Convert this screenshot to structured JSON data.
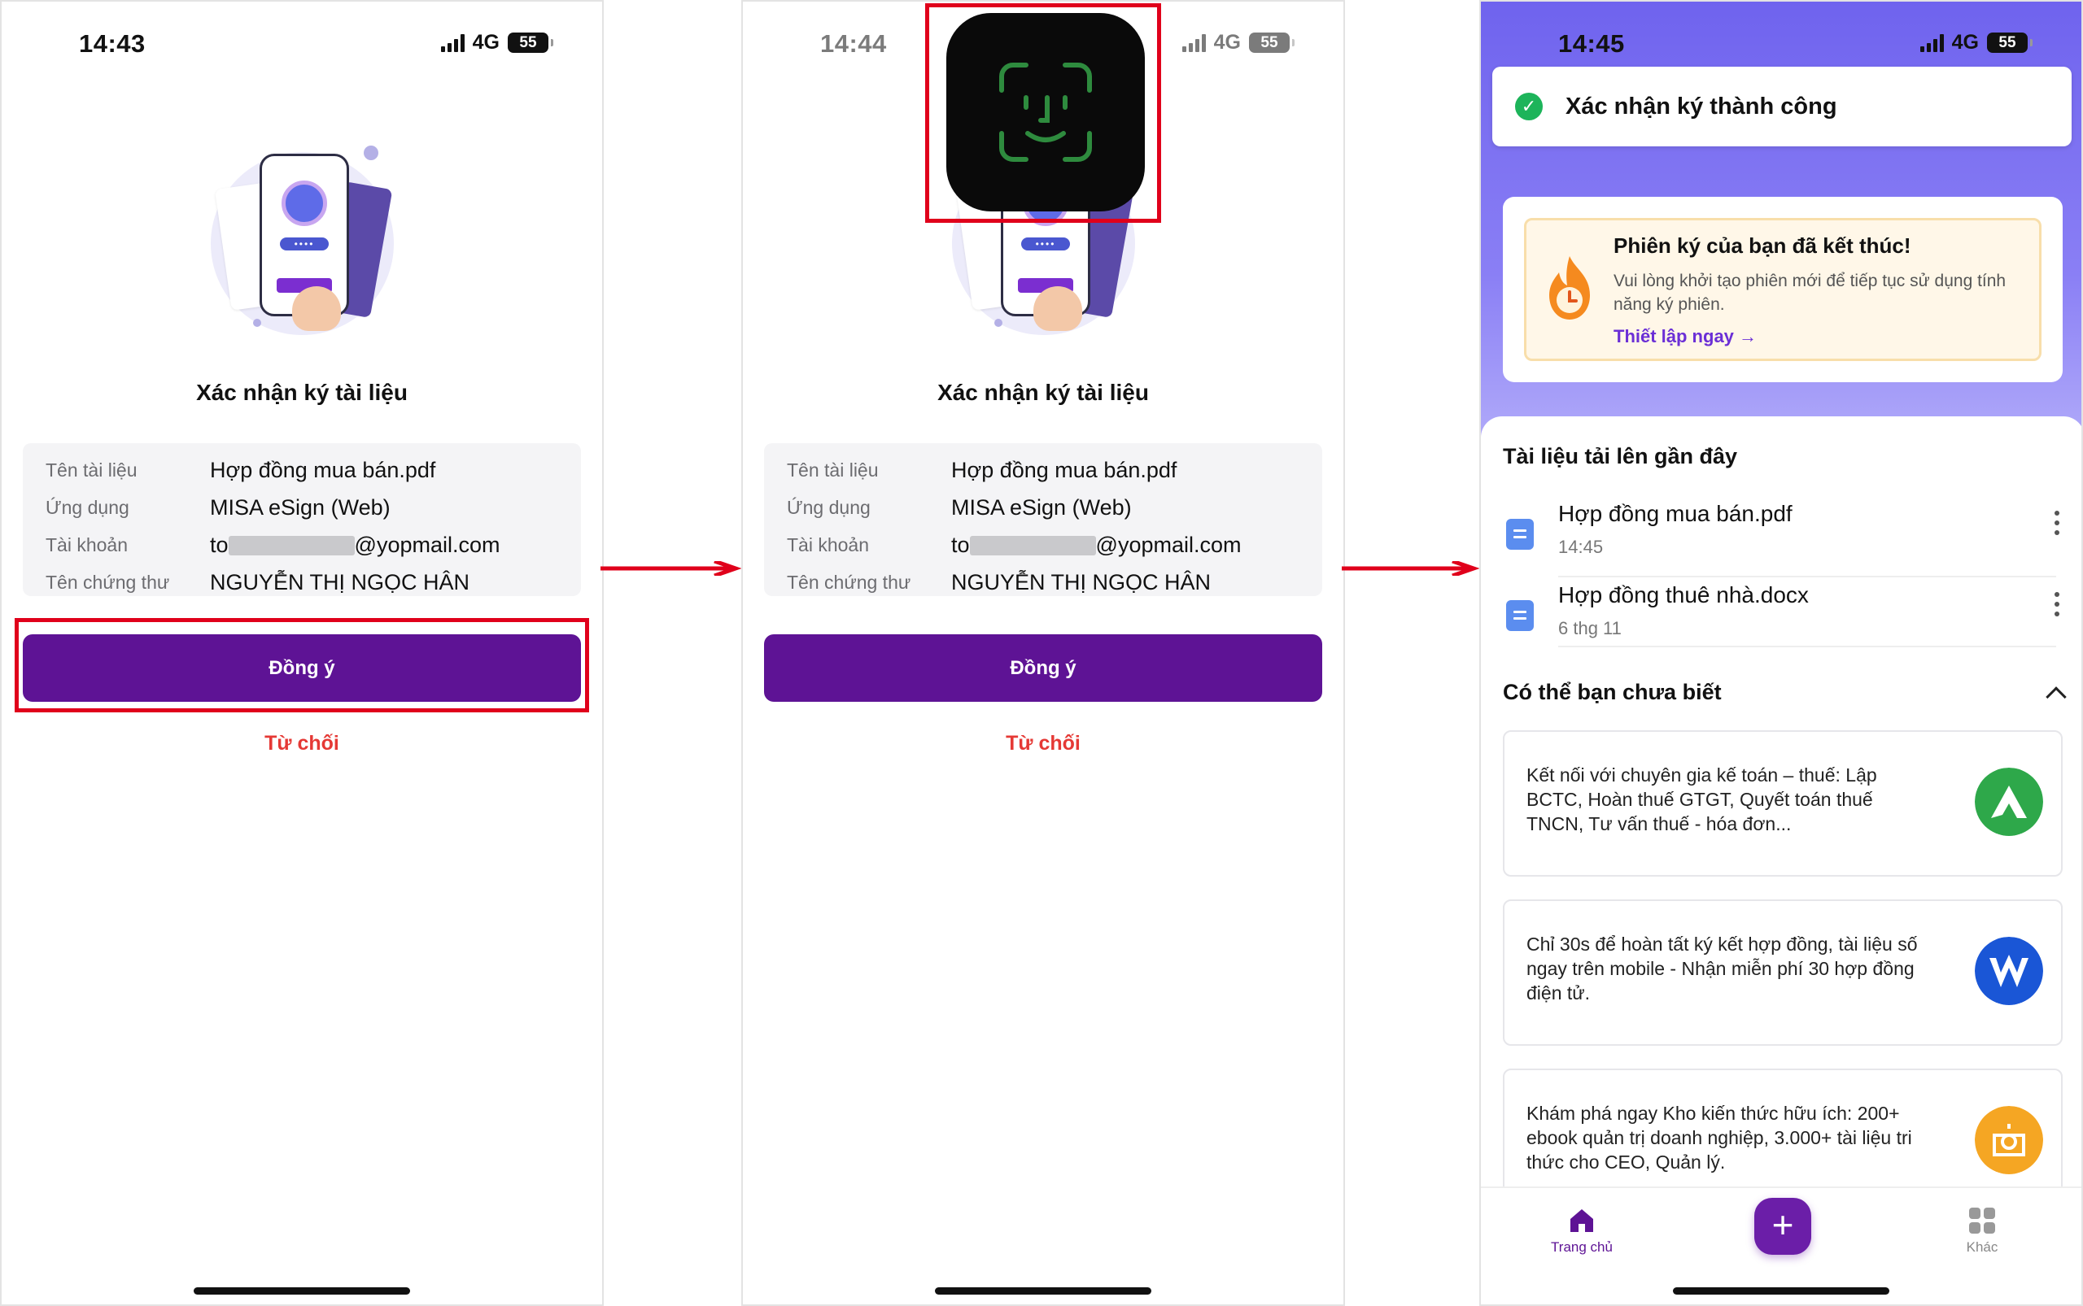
{
  "accent_color": "#5e1395",
  "highlight_color": "#e0001b",
  "screens": [
    {
      "status": {
        "time": "14:43",
        "network": "4G",
        "battery": "55"
      },
      "title": "Xác nhận ký tài liệu",
      "fields": [
        {
          "label": "Tên tài liệu",
          "value": "Hợp đồng mua bán.pdf"
        },
        {
          "label": "Ứng dụng",
          "value": "MISA eSign (Web)"
        },
        {
          "label": "Tài khoản",
          "value_prefix": "to",
          "value_suffix": "@yopmail.com"
        },
        {
          "label": "Tên chứng thư",
          "value": "NGUYỄN THỊ NGỌC HÂN"
        }
      ],
      "agree_label": "Đồng ý",
      "reject_label": "Từ chối"
    },
    {
      "status": {
        "time": "14:44",
        "network": "4G",
        "battery": "55"
      },
      "title": "Xác nhận ký tài liệu",
      "fields": [
        {
          "label": "Tên tài liệu",
          "value": "Hợp đồng mua bán.pdf"
        },
        {
          "label": "Ứng dụng",
          "value": "MISA eSign (Web)"
        },
        {
          "label": "Tài khoản",
          "value_prefix": "to",
          "value_suffix": "@yopmail.com"
        },
        {
          "label": "Tên chứng thư",
          "value": "NGUYỄN THỊ NGỌC HÂN"
        }
      ],
      "agree_label": "Đồng ý",
      "reject_label": "Từ chối",
      "overlay_icon": "face-id-icon"
    },
    {
      "status": {
        "time": "14:45",
        "network": "4G",
        "battery": "55"
      },
      "toast": "Xác nhận ký thành công",
      "session": {
        "title": "Phiên ký của bạn đã kết thúc!",
        "desc": "Vui lòng khởi tạo phiên mới để tiếp tục sử dụng tính năng ký phiên.",
        "link": "Thiết lập ngay →"
      },
      "recent_title": "Tài liệu tải lên gần đây",
      "recent_docs": [
        {
          "name": "Hợp đồng mua bán.pdf",
          "time": "14:45"
        },
        {
          "name": "Hợp đồng thuê nhà.docx",
          "time": "6 thg 11"
        }
      ],
      "tips_title": "Có thể bạn chưa biết",
      "tips": [
        {
          "text": "Kết nối với chuyên gia kế toán – thuế: Lập BCTC, Hoàn thuế GTGT, Quyết toán thuế TNCN, Tư vấn thuế - hóa đơn...",
          "logo_color": "#2ea84a"
        },
        {
          "text": "Chỉ 30s để hoàn tất ký kết hợp đồng, tài liệu số ngay trên mobile - Nhận miễn phí 30 hợp đồng điện tử.",
          "logo_color": "#1a56d6"
        },
        {
          "text": "Khám phá ngay Kho kiến thức hữu ích: 200+ ebook quản trị doanh nghiệp, 3.000+ tài liệu tri thức cho CEO, Quản lý.",
          "logo_color": "#f5a623"
        }
      ],
      "tabbar": {
        "home": "Trang chủ",
        "add": "+",
        "more": "Khác"
      }
    }
  ]
}
